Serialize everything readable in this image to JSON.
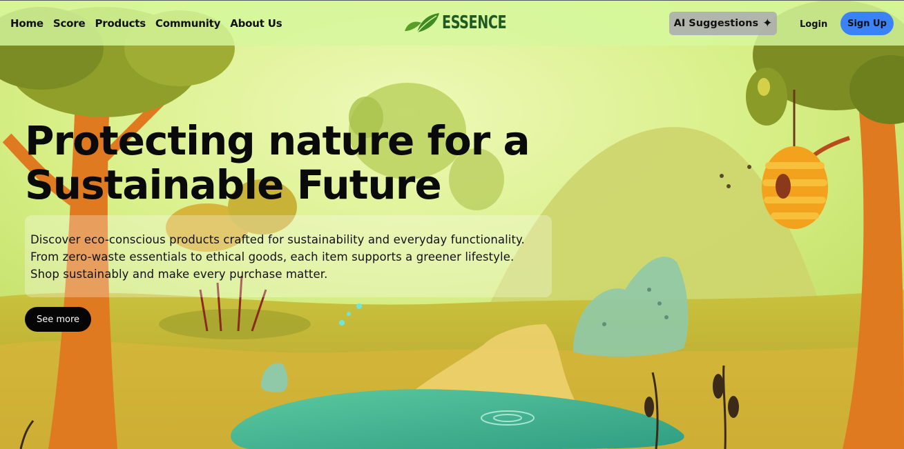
{
  "nav": {
    "links": [
      "Home",
      "Score",
      "Products",
      "Community",
      "About Us"
    ],
    "brand": "ESSENCE",
    "ai_label": "AI Suggestions",
    "ai_icon": "sparkle-icon",
    "login_label": "Login",
    "signup_label": "Sign Up"
  },
  "hero": {
    "title_line1": "Protecting nature for a",
    "title_line2": "Sustainable Future",
    "description": "Discover eco-conscious products crafted for sustainability and everyday functionality. From zero-waste essentials to ethical goods, each item supports a greener lifestyle. Shop sustainably and make every purchase matter.",
    "cta_label": "See more"
  },
  "colors": {
    "nav_bg": "#d6f89e",
    "brand_green": "#1f5a22",
    "signup_blue": "#3b82f6",
    "cta_black": "#050505"
  }
}
